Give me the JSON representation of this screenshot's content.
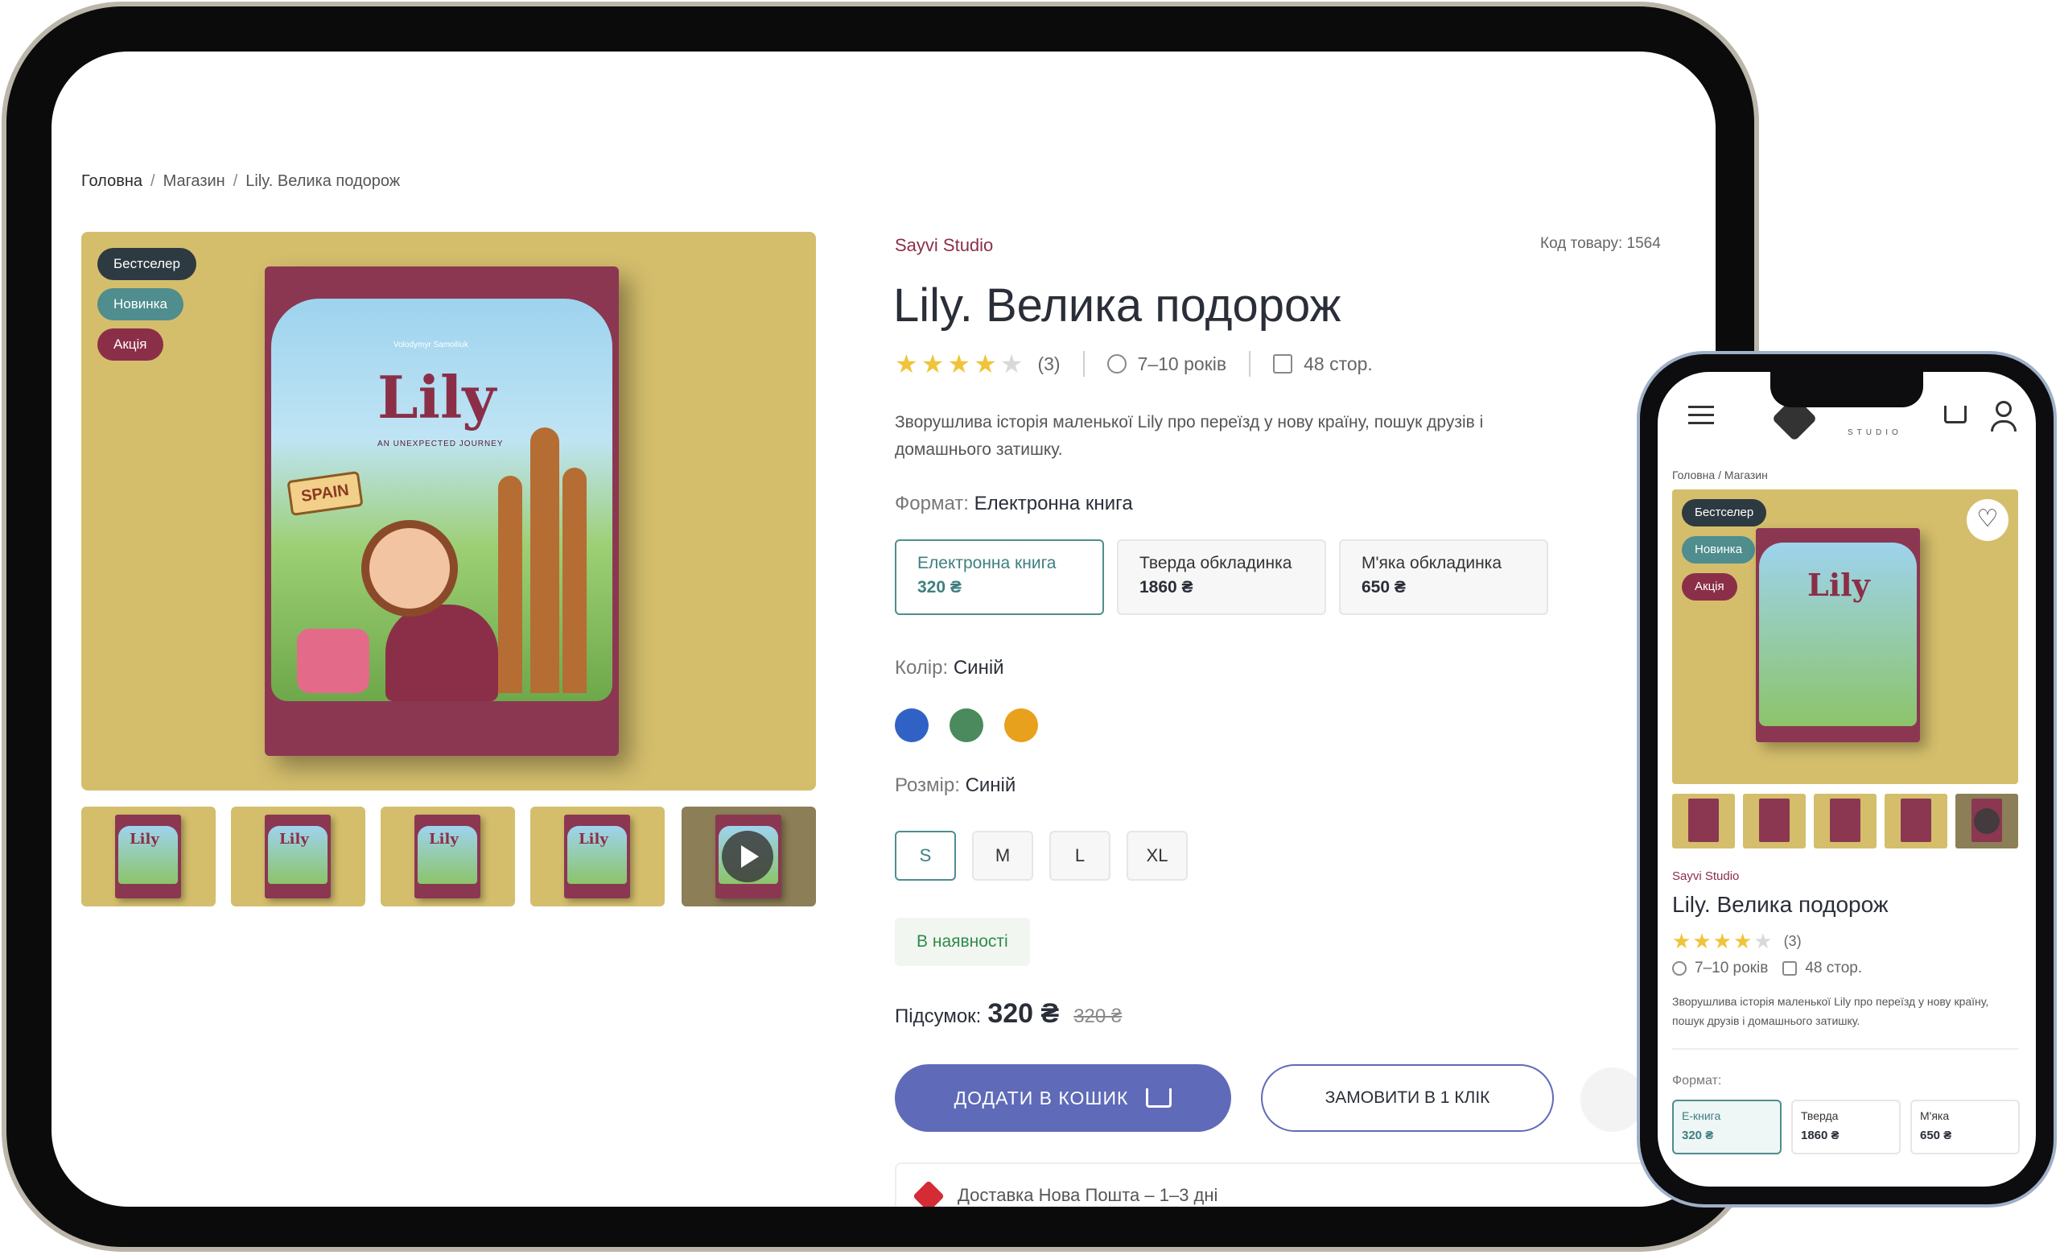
{
  "breadcrumb": {
    "home": "Головна",
    "shop": "Магазин",
    "current": "Lily. Велика подорож",
    "sep": "/"
  },
  "badges": {
    "bestseller": "Бестселер",
    "new": "Новинка",
    "sale": "Акція"
  },
  "book_cover": {
    "title": "Lily",
    "subtitle": "AN UNEXPECTED JOURNEY",
    "author": "Volodymyr Samoiliuk",
    "sign": "SPAIN"
  },
  "product": {
    "brand": "Sayvi Studio",
    "sku_label": "Код товару: 1564",
    "title": "Lily. Велика подорож",
    "rating_stars": 4,
    "rating_count": "(3)",
    "age": "7–10 років",
    "pages": "48 стор.",
    "description": "Зворушлива історія маленької Lily про переїзд у нову країну, пошук друзів і домашнього затишку."
  },
  "format": {
    "label": "Формат:",
    "selected": "Електронна книга",
    "options": [
      {
        "name": "Електронна книга",
        "price": "320 ₴"
      },
      {
        "name": "Тверда обкладинка",
        "price": "1860 ₴"
      },
      {
        "name": "М'яка обкладинка",
        "price": "650 ₴"
      }
    ]
  },
  "color": {
    "label": "Колір:",
    "selected": "Синій",
    "swatches": [
      "#2f62c4",
      "#4a8a5c",
      "#e8a11d"
    ]
  },
  "size": {
    "label": "Розмір:",
    "selected": "Синій",
    "options": [
      "S",
      "M",
      "L",
      "XL"
    ]
  },
  "stock": "В наявності",
  "total": {
    "label": "Підсумок:",
    "price": "320 ₴",
    "old_price": "320 ₴"
  },
  "buttons": {
    "add_to_cart": "ДОДАТИ В КОШИК",
    "one_click": "ЗАМОВИТИ В 1 КЛІК"
  },
  "delivery": "Доставка Нова Пошта – 1–3 дні",
  "mobile": {
    "studio": "STUDIO",
    "breadcrumb": "Головна / Магазин",
    "format_label": "Формат:",
    "format_options": [
      {
        "name": "Е-книга",
        "price": "320 ₴"
      },
      {
        "name": "Тверда",
        "price": "1860 ₴"
      },
      {
        "name": "М'яка",
        "price": "650 ₴"
      }
    ]
  }
}
